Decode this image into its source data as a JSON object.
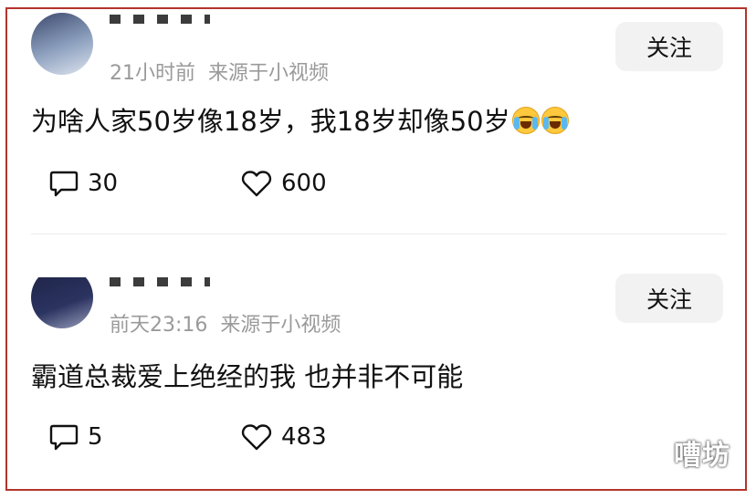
{
  "posts": [
    {
      "time": "21小时前",
      "source": "来源于小视频",
      "follow_label": "关注",
      "text": "为啥人家50岁像18岁，我18岁却像50岁",
      "emoji": [
        "loudly-crying-face",
        "loudly-crying-face"
      ],
      "comments": "30",
      "likes": "600"
    },
    {
      "time": "前天23:16",
      "source": "来源于小视频",
      "follow_label": "关注",
      "text": "霸道总裁爱上绝经的我 也并非不可能",
      "emoji": [],
      "comments": "5",
      "likes": "483"
    }
  ],
  "watermark": "嘈坊",
  "colors": {
    "frame_border": "#b3352c",
    "meta_text": "#9a9a9a",
    "follow_bg": "#f2f2f2"
  },
  "icons": {
    "comment": "speech-bubble-icon",
    "like": "heart-outline-icon"
  }
}
